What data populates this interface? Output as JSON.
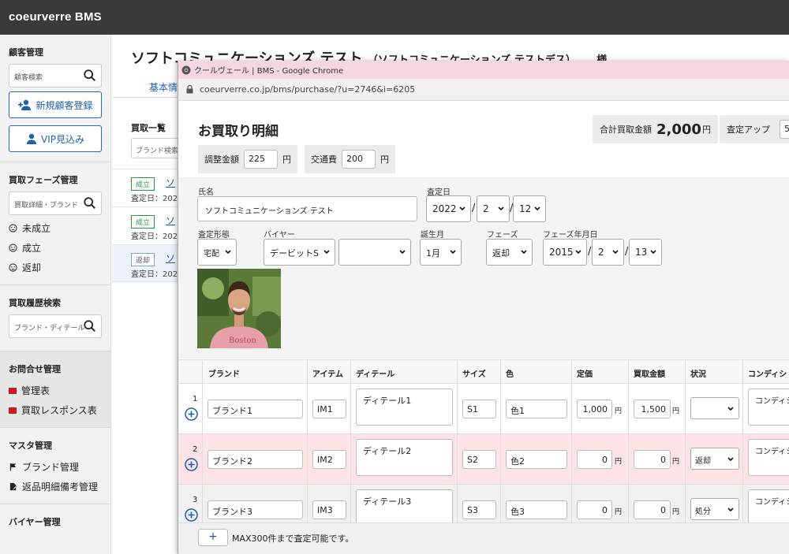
{
  "app": {
    "brand": "coeurverre BMS"
  },
  "sidebar": {
    "customer": {
      "title": "顧客管理",
      "search_placeholder": "顧客検索",
      "new_button": "新規顧客登録",
      "vip_button": "VIP見込み"
    },
    "phase": {
      "title": "買取フェーズ管理",
      "search_placeholder": "買取詳細・ブランド",
      "items": [
        "未成立",
        "成立",
        "返却"
      ]
    },
    "history": {
      "title": "買取履歴検索",
      "search_placeholder": "ブランド・ディテール"
    },
    "inquiry": {
      "title": "お問合せ管理",
      "items": [
        "管理表",
        "買取レスポンス表"
      ]
    },
    "master": {
      "title": "マスタ管理",
      "items": [
        "ブランド管理",
        "返品明細備考管理"
      ]
    },
    "buyer": {
      "title": "バイヤー管理"
    }
  },
  "main": {
    "title": "ソフトコミュニケーションズ テスト",
    "title_kana": "（ソフトコミュニケーションズ テストデス）",
    "title_suffix": "様",
    "tab": "基本情",
    "list": {
      "title": "買取一覧",
      "search_placeholder": "ブランド検索",
      "rows": [
        {
          "badge": "成立",
          "name": "ソ",
          "date": "査定日：202"
        },
        {
          "badge": "成立",
          "name": "ソ",
          "date": "査定日：202"
        },
        {
          "badge": "返却",
          "name": "ソ",
          "date": "査定日：202"
        }
      ]
    }
  },
  "popup": {
    "window_title": "クールヴェール | BMS - Google Chrome",
    "url": "coeurverre.co.jp/bms/purchase/?u=2746&i=6205",
    "heading": "お買取り明細",
    "total_label": "合計買取金額",
    "total_value": "2,000",
    "total_unit": "円",
    "up_label": "査定アップ",
    "up_value": "5",
    "adjust_label": "調整金額",
    "adjust_value": "225",
    "transport_label": "交通費",
    "transport_value": "200",
    "yen": "円",
    "form": {
      "name_label": "氏名",
      "name_value": "ソフトコミュニケーションズ テスト",
      "date_label": "査定日",
      "date_year": "2022",
      "date_month": "2",
      "date_day": "12",
      "method_label": "査定形態",
      "method_value": "宅配",
      "buyer_label": "バイヤー",
      "buyer_value": "デービットS",
      "buyer2_value": "",
      "birth_label": "誕生月",
      "birth_value": "1月",
      "phase_label": "フェーズ",
      "phase_value": "返却",
      "phase_date_label": "フェーズ年月日",
      "phase_year": "2015",
      "phase_month": "2",
      "phase_day": "13",
      "slash": "/"
    },
    "table": {
      "headers": [
        "ブランド",
        "アイテム",
        "ディテール",
        "サイズ",
        "色",
        "定価",
        "買取金額",
        "状況",
        "コンディシ"
      ],
      "rows": [
        {
          "no": "1",
          "brand": "ブランド1",
          "item": "IM1",
          "detail": "ディテール1",
          "size": "S1",
          "color": "色1",
          "price": "1,000",
          "buy": "1,500",
          "status": "",
          "cond": "コンディシ"
        },
        {
          "no": "2",
          "brand": "ブランド2",
          "item": "IM2",
          "detail": "ディテール2",
          "size": "S2",
          "color": "色2",
          "price": "0",
          "buy": "0",
          "status": "返却",
          "cond": "コンディシ"
        },
        {
          "no": "3",
          "brand": "ブランド3",
          "item": "IM3",
          "detail": "ディテール3",
          "size": "S3",
          "color": "色3",
          "price": "0",
          "buy": "0",
          "status": "処分",
          "cond": "コンディシ"
        }
      ],
      "row_colors": [
        "#ffffff",
        "#fde3e6",
        "#f1f1f1"
      ]
    },
    "footer_add": "+",
    "footer_text": "MAX300件まで査定可能です。"
  }
}
